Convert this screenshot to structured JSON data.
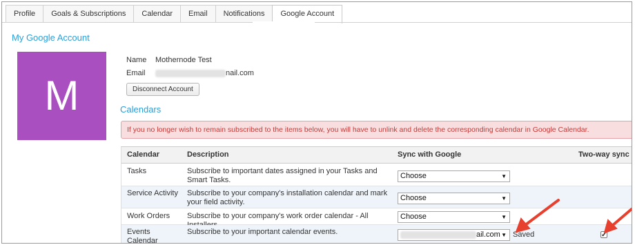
{
  "tabs": [
    {
      "label": "Profile"
    },
    {
      "label": "Goals & Subscriptions"
    },
    {
      "label": "Calendar"
    },
    {
      "label": "Email"
    },
    {
      "label": "Notifications"
    },
    {
      "label": "Google Account",
      "active": true
    }
  ],
  "account": {
    "title": "My Google Account",
    "avatar_letter": "M",
    "avatar_color": "#a94fc0",
    "name_label": "Name",
    "name_value": "Mothernode Test",
    "email_label": "Email",
    "email_suffix": "nail.com",
    "disconnect_label": "Disconnect Account"
  },
  "calendars": {
    "title": "Calendars",
    "alert": "If you no longer wish to remain subscribed to the items below, you will have to unlink and delete the corresponding calendar in Google Calendar.",
    "headers": {
      "calendar": "Calendar",
      "description": "Description",
      "sync": "Sync with Google",
      "twoway": "Two-way sync"
    },
    "rows": [
      {
        "calendar": "Tasks",
        "description": "Subscribe to important dates assigned in your Tasks and Smart Tasks.",
        "sync": "Choose"
      },
      {
        "calendar": "Service Activity",
        "description": "Subscribe to your company's installation calendar and mark your field activity.",
        "sync": "Choose"
      },
      {
        "calendar": "Work Orders",
        "description": "Subscribe to your company's work order calendar - All Installers.",
        "sync": "Choose"
      },
      {
        "calendar": "Events Calendar",
        "description": "Subscribe to your important calendar events.",
        "sync_suffix": "ail.com",
        "status": "Saved",
        "two_way_checked": true
      }
    ]
  },
  "colors": {
    "accent": "#2a9fd8",
    "alert_bg": "#f8dede",
    "alert_text": "#c53a3a",
    "arrow": "#e8402f"
  },
  "icons": {
    "dropdown": "chevron-down-icon",
    "checkbox": "checkmark-icon",
    "annotation": "red-arrow-icon"
  }
}
